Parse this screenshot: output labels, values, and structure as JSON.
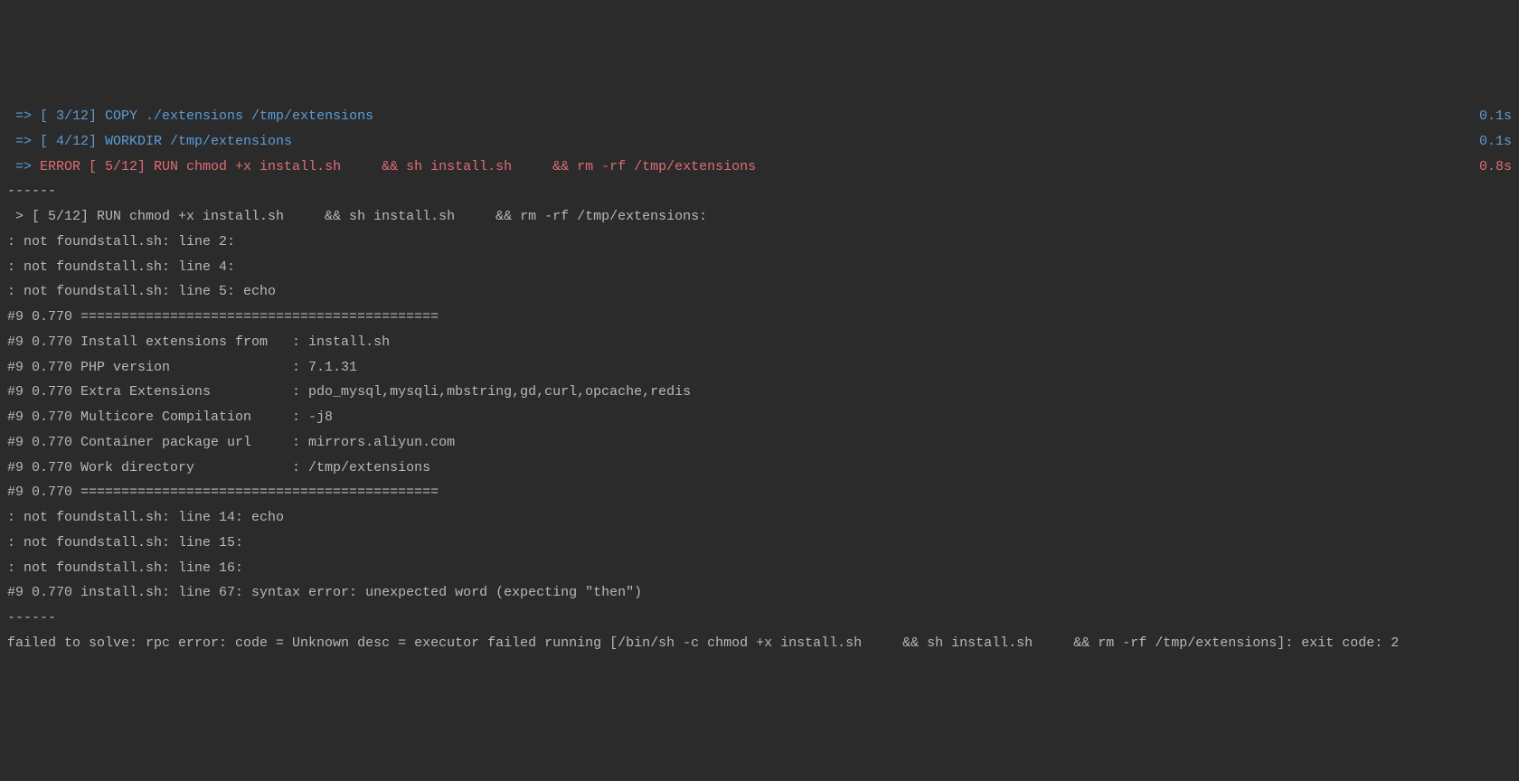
{
  "lines": {
    "step3": {
      "prefix": " => ",
      "text": "[ 3/12] COPY ./extensions /tmp/extensions",
      "time": "0.1s"
    },
    "step4": {
      "prefix": " => ",
      "text": "[ 4/12] WORKDIR /tmp/extensions",
      "time": "0.1s"
    },
    "step5_error": {
      "prefix": " => ",
      "text": "ERROR [ 5/12] RUN chmod +x install.sh     && sh install.sh     && rm -rf /tmp/extensions",
      "time": "0.8s"
    },
    "dash1": "------",
    "run_header": " > [ 5/12] RUN chmod +x install.sh     && sh install.sh     && rm -rf /tmp/extensions:",
    "nf_line2": ": not foundstall.sh: line 2: ",
    "nf_line4": ": not foundstall.sh: line 4: ",
    "nf_line5": ": not foundstall.sh: line 5: echo",
    "border1": "#9 0.770 ============================================",
    "info_install": "#9 0.770 Install extensions from   : install.sh",
    "info_php": "#9 0.770 PHP version               : 7.1.31",
    "info_ext": "#9 0.770 Extra Extensions          : pdo_mysql,mysqli,mbstring,gd,curl,opcache,redis",
    "info_multi": "#9 0.770 Multicore Compilation     : -j8",
    "info_url": "#9 0.770 Container package url     : mirrors.aliyun.com",
    "info_workdir": "#9 0.770 Work directory            : /tmp/extensions",
    "border2": "#9 0.770 ============================================",
    "nf_line14": ": not foundstall.sh: line 14: echo",
    "nf_line15": ": not foundstall.sh: line 15: ",
    "nf_line16": ": not foundstall.sh: line 16: ",
    "syntax_err": "#9 0.770 install.sh: line 67: syntax error: unexpected word (expecting \"then\")",
    "dash2": "------",
    "failed": "failed to solve: rpc error: code = Unknown desc = executor failed running [/bin/sh -c chmod +x install.sh     && sh install.sh     && rm -rf /tmp/extensions]: exit code: 2"
  }
}
